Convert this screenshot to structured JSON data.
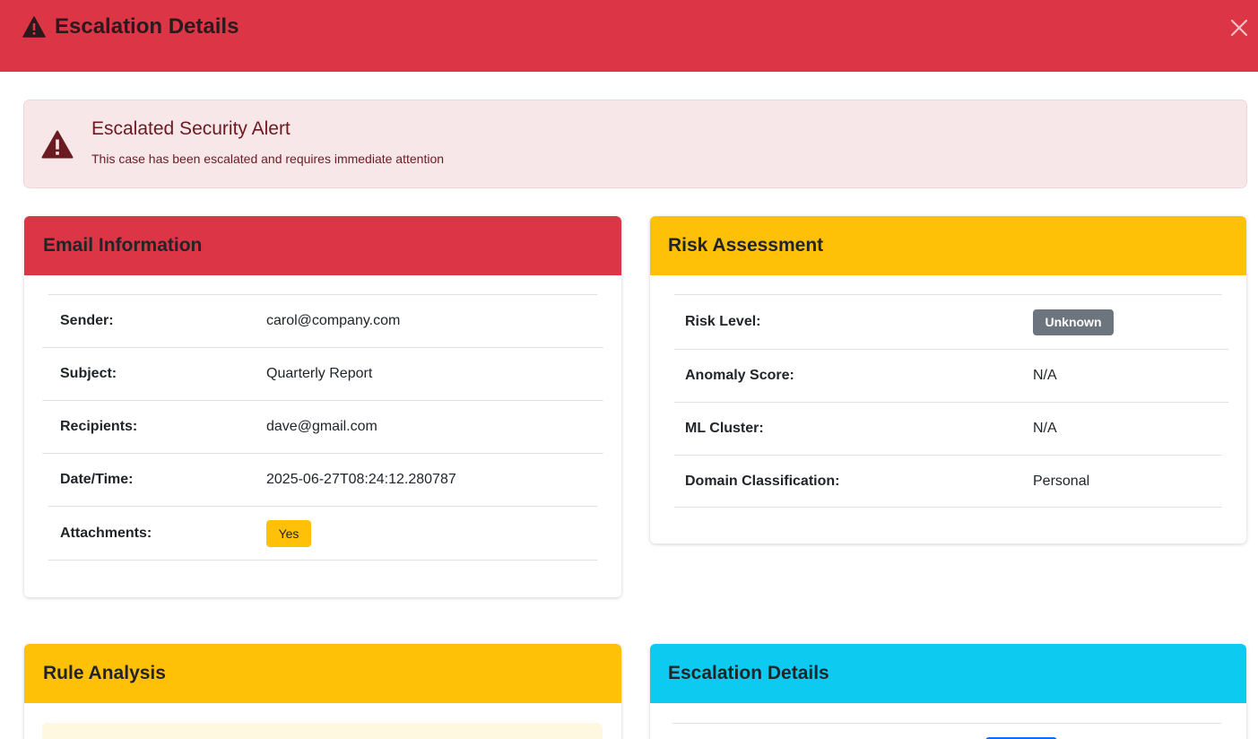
{
  "modal": {
    "title": "Escalation Details",
    "icon": "warning-triangle-icon",
    "close_icon": "close-icon"
  },
  "alert": {
    "title": "Escalated Security Alert",
    "text": "This case has been escalated and requires immediate attention"
  },
  "email_info": {
    "header": "Email Information",
    "rows": [
      {
        "label": "Sender:",
        "value": "carol@company.com"
      },
      {
        "label": "Subject:",
        "value": "Quarterly Report"
      },
      {
        "label": "Recipients:",
        "value": "dave@gmail.com"
      },
      {
        "label": "Date/Time:",
        "value": "2025-06-27T08:24:12.280787"
      },
      {
        "label": "Attachments:",
        "value": "Yes"
      }
    ]
  },
  "risk": {
    "header": "Risk Assessment",
    "rows": [
      {
        "label": "Risk Level:",
        "value": "Unknown"
      },
      {
        "label": "Anomaly Score:",
        "value": "N/A"
      },
      {
        "label": "ML Cluster:",
        "value": "N/A"
      },
      {
        "label": "Domain Classification:",
        "value": "Personal"
      }
    ]
  },
  "rule_analysis": {
    "header": "Rule Analysis"
  },
  "escalation_details": {
    "header": "Escalation Details"
  },
  "colors": {
    "danger": "#dc3545",
    "warning": "#ffc107",
    "info": "#0dcaf0",
    "secondary": "#6c757d",
    "alert_bg": "#f8e7e9"
  }
}
